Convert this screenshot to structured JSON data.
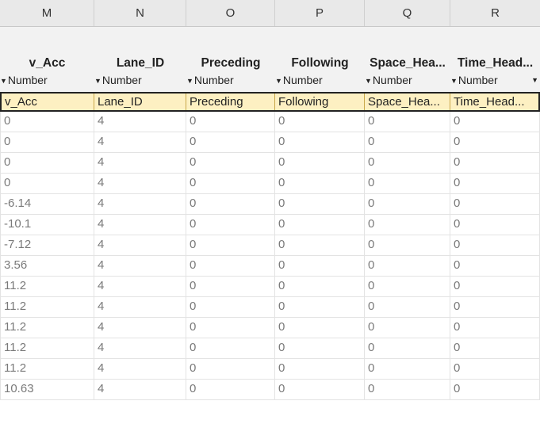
{
  "columns": {
    "letters": [
      "M",
      "N",
      "O",
      "P",
      "Q",
      "R"
    ],
    "names": [
      "v_Acc",
      "Lane_ID",
      "Preceding",
      "Following",
      "Space_Hea...",
      "Time_Head..."
    ],
    "types": [
      "Number",
      "Number",
      "Number",
      "Number",
      "Number",
      "Number"
    ],
    "header_values": [
      "v_Acc",
      "Lane_ID",
      "Preceding",
      "Following",
      "Space_Hea...",
      "Time_Head..."
    ]
  },
  "rows": [
    [
      "0",
      "4",
      "0",
      "0",
      "0",
      "0"
    ],
    [
      "0",
      "4",
      "0",
      "0",
      "0",
      "0"
    ],
    [
      "0",
      "4",
      "0",
      "0",
      "0",
      "0"
    ],
    [
      "0",
      "4",
      "0",
      "0",
      "0",
      "0"
    ],
    [
      "-6.14",
      "4",
      "0",
      "0",
      "0",
      "0"
    ],
    [
      "-10.1",
      "4",
      "0",
      "0",
      "0",
      "0"
    ],
    [
      "-7.12",
      "4",
      "0",
      "0",
      "0",
      "0"
    ],
    [
      "3.56",
      "4",
      "0",
      "0",
      "0",
      "0"
    ],
    [
      "11.2",
      "4",
      "0",
      "0",
      "0",
      "0"
    ],
    [
      "11.2",
      "4",
      "0",
      "0",
      "0",
      "0"
    ],
    [
      "11.2",
      "4",
      "0",
      "0",
      "0",
      "0"
    ],
    [
      "11.2",
      "4",
      "0",
      "0",
      "0",
      "0"
    ],
    [
      "11.2",
      "4",
      "0",
      "0",
      "0",
      "0"
    ],
    [
      "10.63",
      "4",
      "0",
      "0",
      "0",
      "0"
    ]
  ]
}
